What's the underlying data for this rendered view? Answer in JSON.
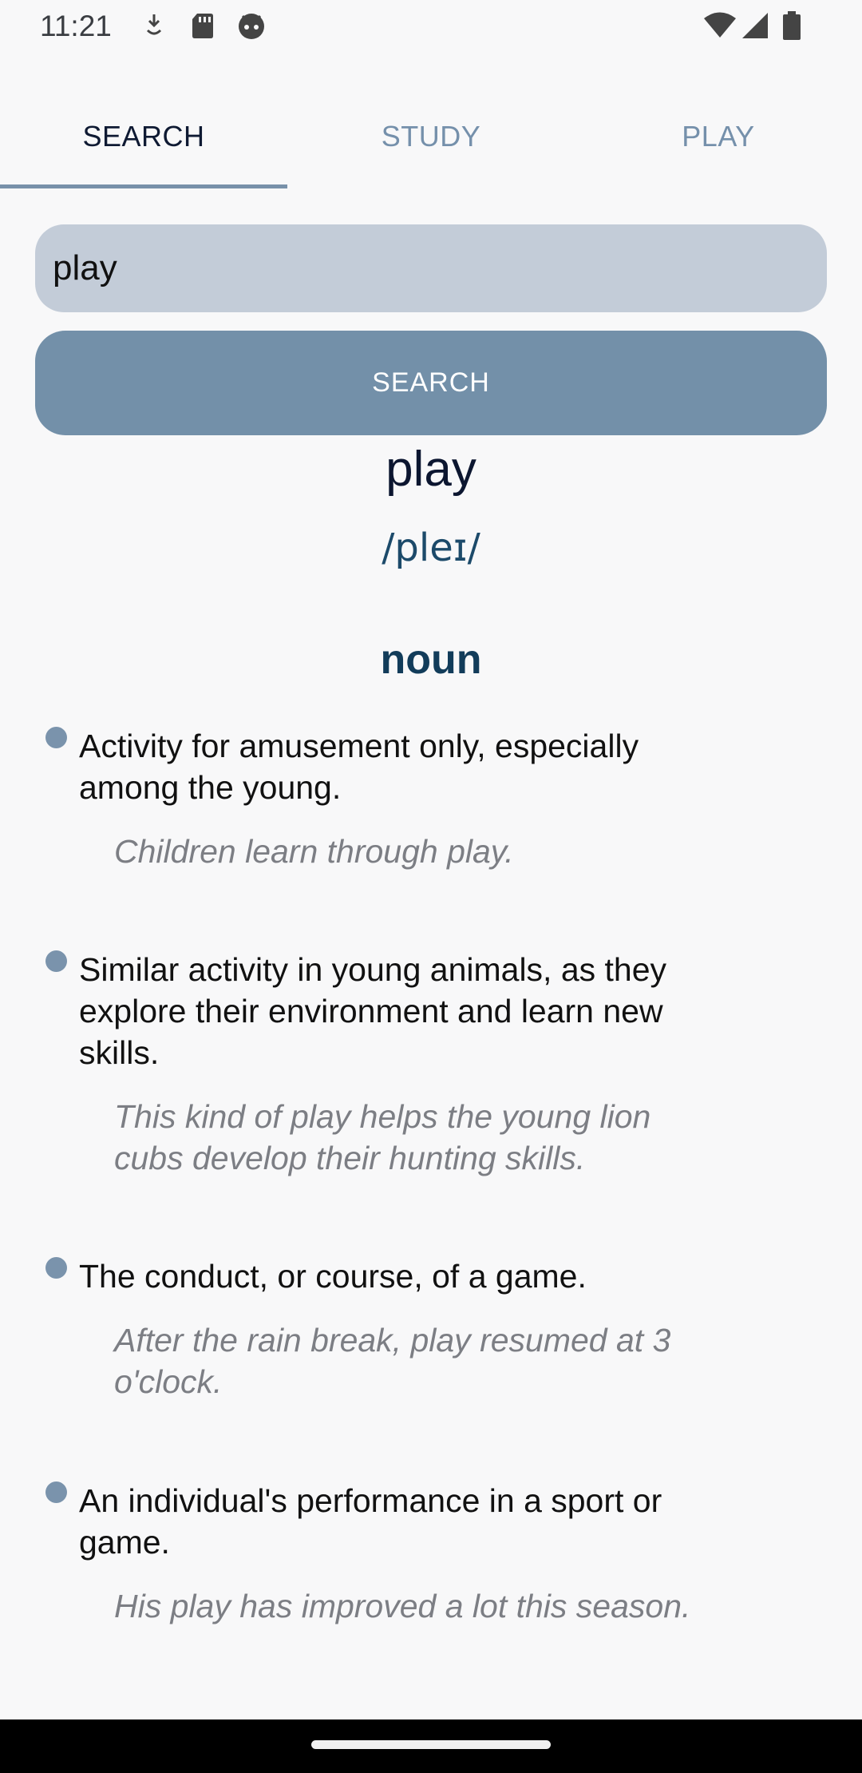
{
  "status_bar": {
    "time": "11:21",
    "left_icons": [
      "download-icon",
      "sd-card-icon",
      "android-icon"
    ],
    "right_icons": [
      "wifi-icon",
      "signal-icon",
      "battery-icon"
    ]
  },
  "tabs": [
    {
      "label": "SEARCH",
      "active": true
    },
    {
      "label": "STUDY",
      "active": false
    },
    {
      "label": "PLAY",
      "active": false
    }
  ],
  "search": {
    "value": "play",
    "button_label": "SEARCH"
  },
  "result": {
    "word": "play",
    "phonetic": "/pleɪ/",
    "part_of_speech": "noun",
    "definitions": [
      {
        "definition": "Activity for amusement only, especially among the young.",
        "example": "Children learn through play."
      },
      {
        "definition": "Similar activity in young animals, as they explore their environment and learn new skills.",
        "example": "This kind of play helps the young lion cubs develop their hunting skills."
      },
      {
        "definition": "The conduct, or course, of a game.",
        "example": "After the rain break, play resumed at 3 o'clock."
      },
      {
        "definition": "An individual's performance in a sport or game.",
        "example": "His play has improved a lot this season."
      }
    ]
  },
  "colors": {
    "accent": "#7390a9",
    "input_bg": "#c3ccd8",
    "part_of_speech": "#123c5a"
  }
}
